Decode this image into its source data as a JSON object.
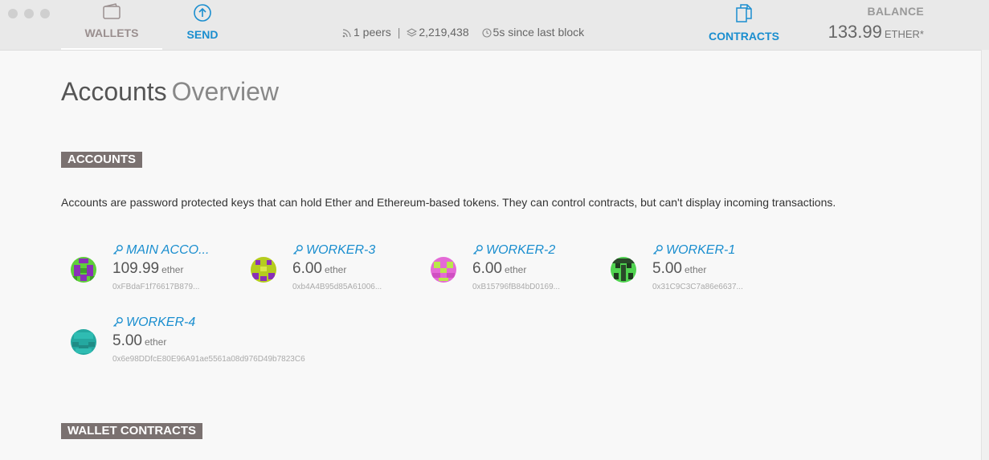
{
  "nav": {
    "wallets": "WALLETS",
    "send": "SEND",
    "contracts": "CONTRACTS",
    "icons": {
      "wallets": "wallet-icon",
      "send": "arrow-up-circle-icon",
      "contracts": "documents-icon"
    }
  },
  "status": {
    "peers": "1 peers",
    "separator": "|",
    "block": "2,219,438",
    "since": "5s since last block"
  },
  "balance": {
    "label": "BALANCE",
    "amount": "133.99",
    "unit": "ETHER*"
  },
  "page": {
    "title_strong": "Accounts",
    "title_light": "Overview"
  },
  "sections": {
    "accounts": "ACCOUNTS",
    "accounts_desc": "Accounts are password protected keys that can hold Ether and Ethereum-based tokens. They can control contracts, but can't display incoming transactions.",
    "wallet_contracts": "WALLET CONTRACTS"
  },
  "accounts": [
    {
      "name": "MAIN ACCO...",
      "amount": "109.99",
      "unit": "ether",
      "address": "0xFBdaF1f76617B879..."
    },
    {
      "name": "WORKER-3",
      "amount": "6.00",
      "unit": "ether",
      "address": "0xb4A4B95d85A61006..."
    },
    {
      "name": "WORKER-2",
      "amount": "6.00",
      "unit": "ether",
      "address": "0xB15796fB84bD0169..."
    },
    {
      "name": "WORKER-1",
      "amount": "5.00",
      "unit": "ether",
      "address": "0x31C9C3C7a86e6637..."
    },
    {
      "name": "WORKER-4",
      "amount": "5.00",
      "unit": "ether",
      "address": "0x6e98DDfcE80E96A91ae5561a08d976D49b7823C6"
    }
  ],
  "colors": {
    "accent": "#1a8ecf",
    "tag_bg": "#7a7170",
    "topbar_bg": "#e9e9e9"
  }
}
